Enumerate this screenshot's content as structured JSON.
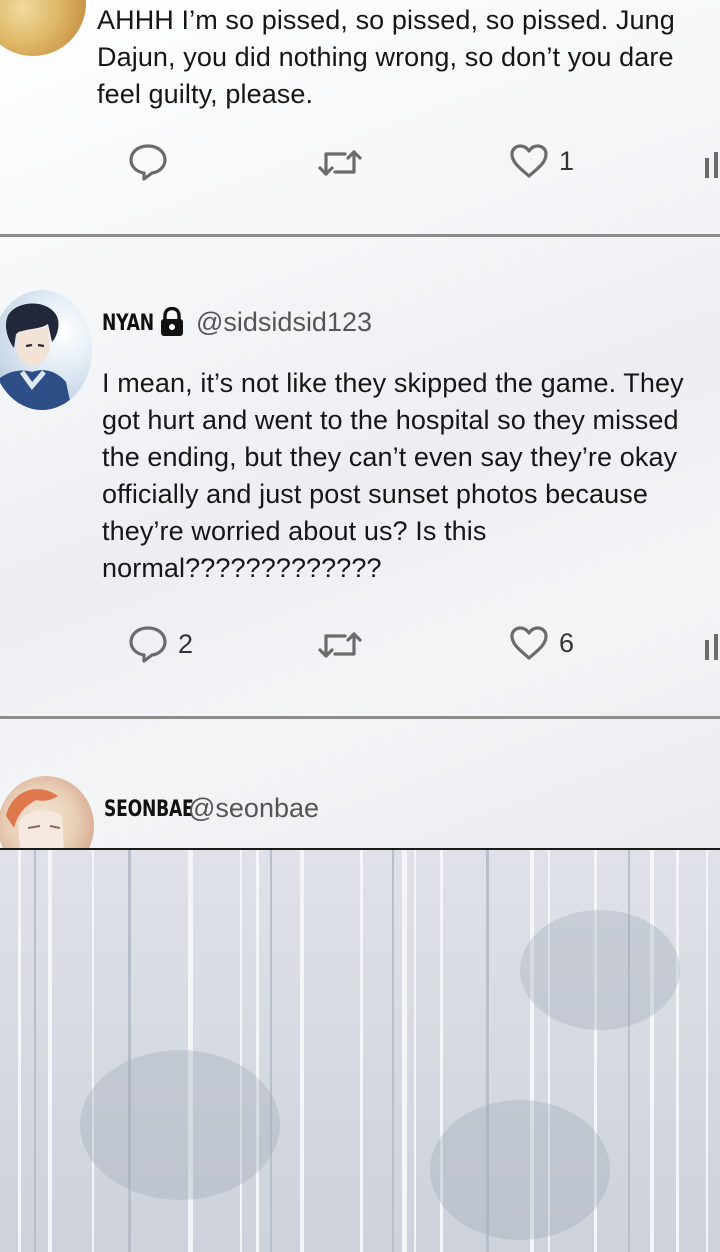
{
  "tweets": [
    {
      "text": "AHHH I’m so pissed, so pissed, so pissed. Jung Dajun, you did nothing wrong, so don’t you dare feel guilty, please.",
      "replies": "",
      "likes": "1"
    },
    {
      "name": "NYAN",
      "handle": "@sidsidsid123",
      "text": "I mean, it’s not like they skipped the game. They got hurt and went to the hospital so they missed the ending, but they can’t even say they’re okay officially and just post sunset photos because they’re worried about us? Is this normal?????????????",
      "replies": "2",
      "likes": "6"
    },
    {
      "name": "SEONBAE",
      "handle": "@seonbae"
    }
  ],
  "colors": {
    "text": "#161616",
    "handle": "#555555",
    "icon": "#6b6b6b",
    "divider": "#8c8c8c"
  },
  "icons": [
    "reply-icon",
    "retweet-icon",
    "like-icon",
    "stats-icon",
    "lock-icon"
  ]
}
